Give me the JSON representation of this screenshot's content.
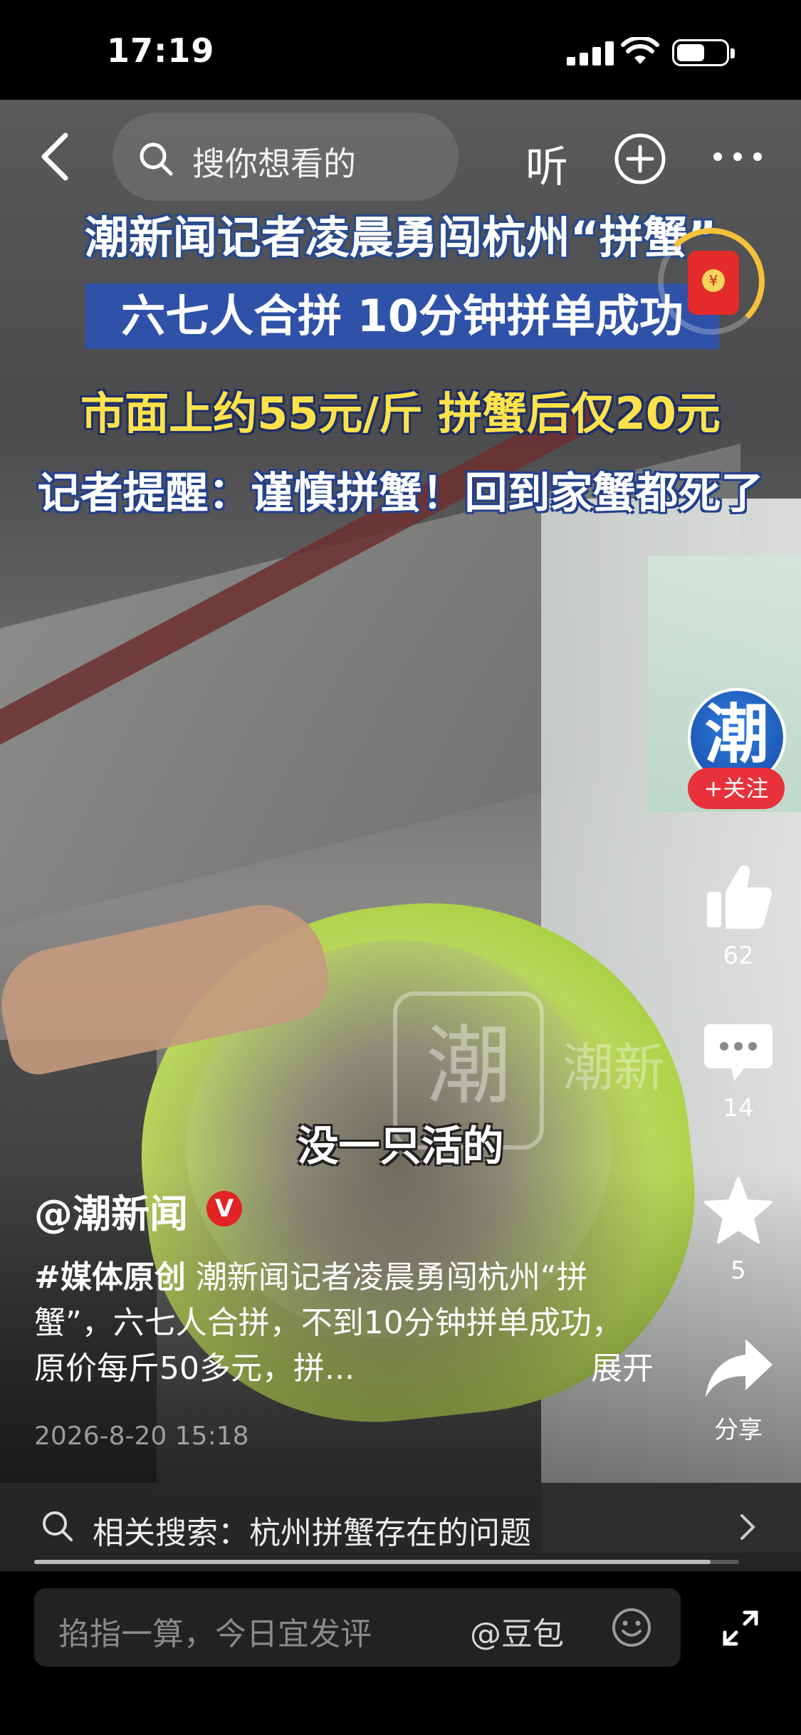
{
  "status_bar": {
    "time": "17:19"
  },
  "top_bar": {
    "search_placeholder": "搜你想看的",
    "listen_label": "听"
  },
  "video": {
    "headline_1": "潮新闻记者凌晨勇闯杭州“拼蟹”",
    "headline_2": "六七人合拼 10分钟拼单成功",
    "headline_3": "市面上约55元/斤 拼蟹后仅20元",
    "headline_4": "记者提醒：谨慎拼蟹！回到家蟹都死了",
    "subtitle": "没一只活的",
    "watermark_char": "潮",
    "watermark_text": "潮新"
  },
  "red_packet": {
    "symbol": "¥"
  },
  "sidebar": {
    "avatar_char": "潮",
    "follow_label": "+关注",
    "like_count": "62",
    "comment_count": "14",
    "favorite_count": "5",
    "share_label": "分享"
  },
  "post": {
    "author": "@潮新闻",
    "verified_mark": "V",
    "hashtag": "#媒体原创",
    "description": " 潮新闻记者凌晨勇闯杭州“拼蟹”，六七人合拼，不到10分钟拼单成功，原价每斤50多元，拼...",
    "expand_label": "展开",
    "date": "2026-8-20 15:18"
  },
  "related_search": {
    "text": "相关搜索：杭州拼蟹存在的问题"
  },
  "playback": {
    "progress": 0.96
  },
  "comment_bar": {
    "placeholder": "掐指一算，今日宜发评",
    "mention": "@豆包"
  },
  "colors": {
    "follow_red": "#e8313a",
    "headline_yellow": "#ffe24a",
    "headline_blue": "#2f52a8"
  }
}
